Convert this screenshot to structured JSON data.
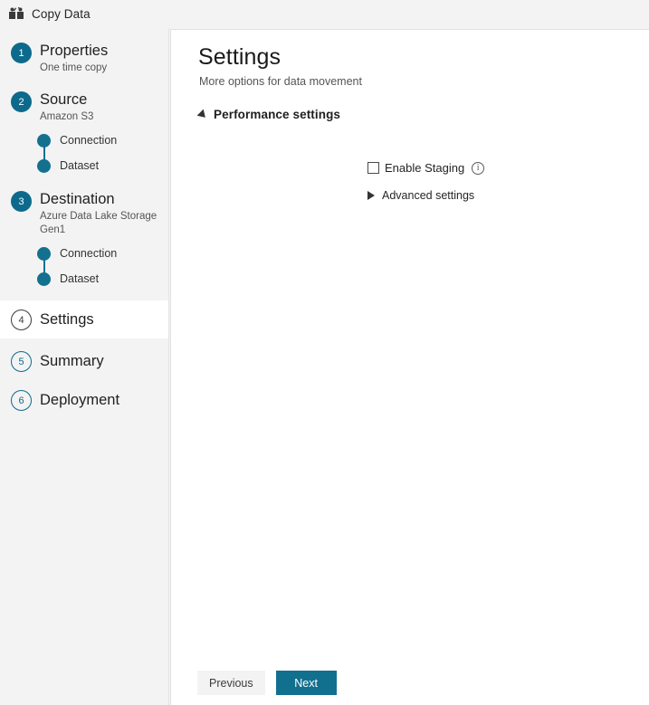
{
  "window": {
    "title": "Copy Data",
    "icon": "copy-data-icon"
  },
  "sidebar": {
    "steps": [
      {
        "number": "1",
        "label": "Properties",
        "sublabel": "One time copy",
        "state": "complete",
        "children": []
      },
      {
        "number": "2",
        "label": "Source",
        "sublabel": "Amazon S3",
        "state": "complete",
        "children": [
          {
            "label": "Connection"
          },
          {
            "label": "Dataset"
          }
        ]
      },
      {
        "number": "3",
        "label": "Destination",
        "sublabel": "Azure Data Lake Storage Gen1",
        "state": "complete",
        "children": [
          {
            "label": "Connection"
          },
          {
            "label": "Dataset"
          }
        ]
      },
      {
        "number": "4",
        "label": "Settings",
        "sublabel": "",
        "state": "active",
        "children": []
      },
      {
        "number": "5",
        "label": "Summary",
        "sublabel": "",
        "state": "pending",
        "children": []
      },
      {
        "number": "6",
        "label": "Deployment",
        "sublabel": "",
        "state": "pending",
        "children": []
      }
    ]
  },
  "main": {
    "title": "Settings",
    "subtitle": "More options for data movement",
    "performance_section": {
      "title": "Performance settings",
      "expanded": true,
      "toggle_icon": "triangle-down-icon",
      "enable_staging": {
        "label": "Enable Staging",
        "checked": false,
        "info_icon": "info-icon",
        "info_glyph": "i"
      }
    },
    "advanced_section": {
      "title": "Advanced settings",
      "expanded": false,
      "toggle_icon": "triangle-right-icon"
    }
  },
  "footer": {
    "previous_label": "Previous",
    "next_label": "Next"
  },
  "colors": {
    "accent_teal": "#0d6a8c",
    "primary_button": "#12708f",
    "sidebar_bg": "#f3f3f3",
    "panel_bg": "#ffffff"
  }
}
